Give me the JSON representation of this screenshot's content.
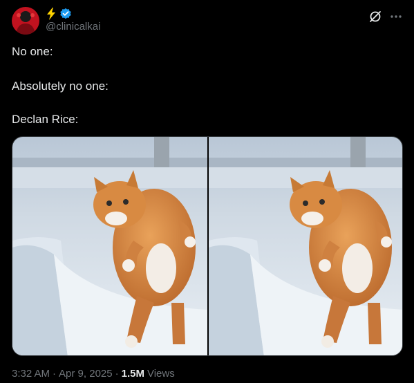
{
  "author": {
    "handle": "@clinicalkai",
    "name_emoji": "lightning-icon",
    "verified": true
  },
  "post": {
    "lines": [
      "No one:",
      "Absolutely no one:",
      "Declan Rice:"
    ],
    "media_count": 2
  },
  "footer": {
    "time": "3:32 AM",
    "sep1": "·",
    "date": "Apr 9, 2025",
    "sep2": "·",
    "views_count": "1.5M",
    "views_label": "Views"
  },
  "colors": {
    "background": "#000000",
    "text": "#e7e9ea",
    "muted": "#71767b",
    "verified": "#1d9bf0",
    "bolt": "#ffd400"
  }
}
